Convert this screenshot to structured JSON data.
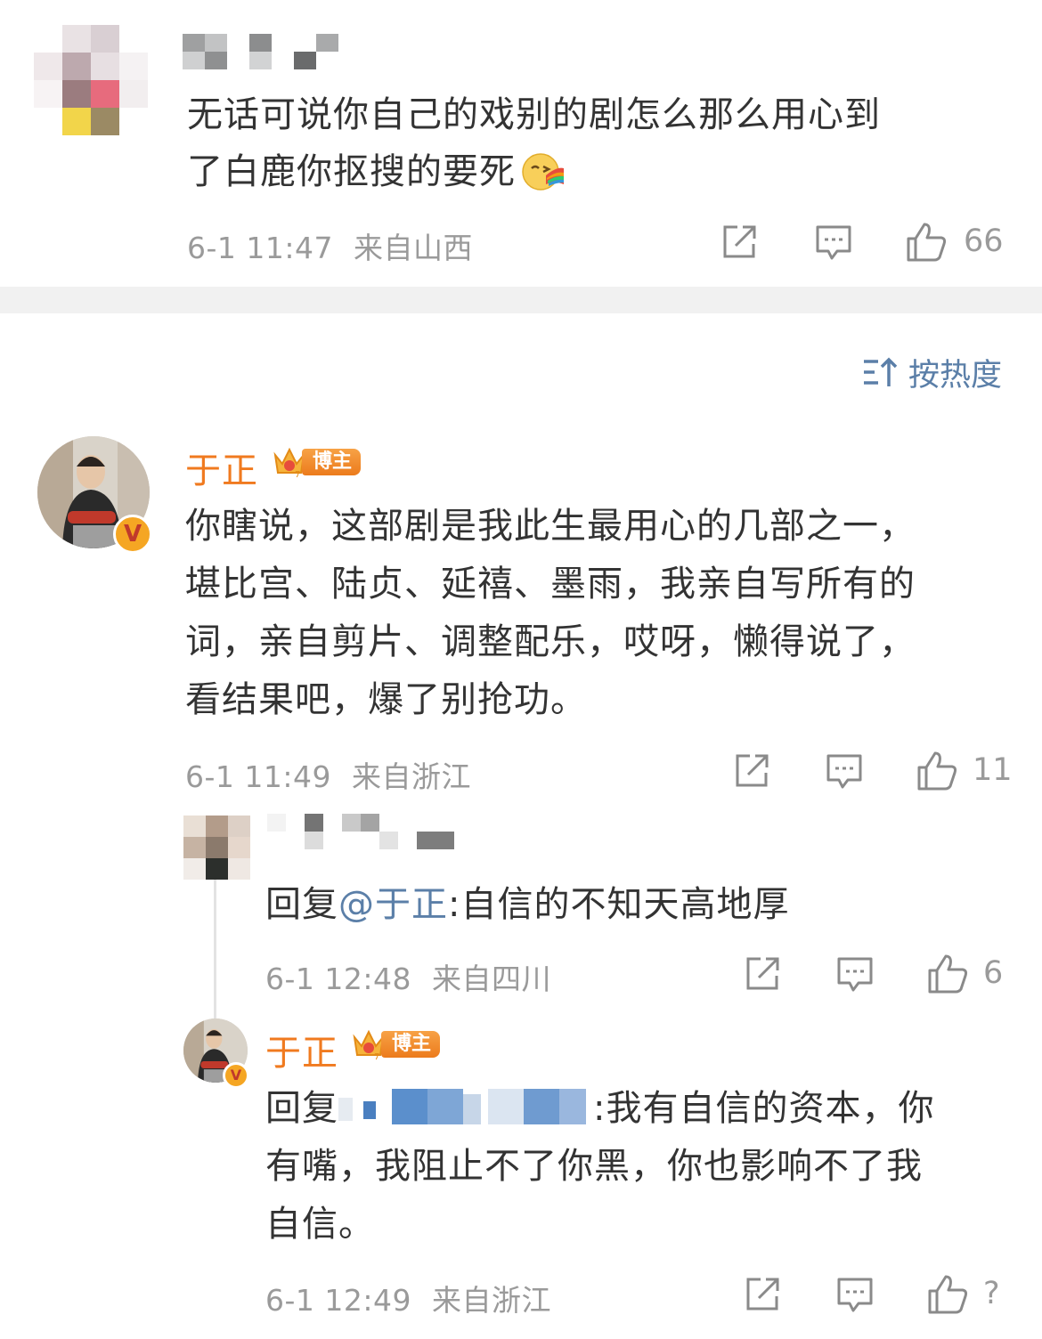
{
  "comments": [
    {
      "text": "无话可说你自己的戏别的剧怎么那么用心到了白鹿你抠搜的要死",
      "line1": "无话可说你自己的戏别的剧怎么那么用心到",
      "line2": "了白鹿你抠搜的要死",
      "time": "6-1 11:47",
      "location": "来自山西",
      "likes": "66",
      "emoji_icon": "rainbow-vomit-emoji"
    },
    {
      "author": "于正",
      "badge": "博主",
      "lines": [
        "你瞎说，这部剧是我此生最用心的几部之一，",
        "堪比宫、陆贞、延禧、墨雨，我亲自写所有的",
        "词，亲自剪片、调整配乐，哎呀，懒得说了，",
        "看结果吧，爆了别抢功。"
      ],
      "time": "6-1 11:49",
      "location": "来自浙江",
      "likes": "11"
    }
  ],
  "sort": {
    "label": "按热度",
    "icon": "sort-icon"
  },
  "replies": [
    {
      "prefix": "回复",
      "mention": "@于正",
      "body": ":自信的不知天高地厚",
      "time": "6-1 12:48",
      "location": "来自四川",
      "likes": "6"
    },
    {
      "author": "于正",
      "badge": "博主",
      "prefix": "回复",
      "line1_rest": ":我有自信的资本，你",
      "line2": "有嘴，我阻止不了你黑，你也影响不了我",
      "line3": "自信。",
      "time": "6-1 12:49",
      "location": "来自浙江",
      "likes": "?"
    }
  ],
  "colors": {
    "author": "#f07a1f",
    "mention": "#5b7fa8",
    "meta": "#9a9a9a",
    "divider": "#f1f1f1"
  }
}
